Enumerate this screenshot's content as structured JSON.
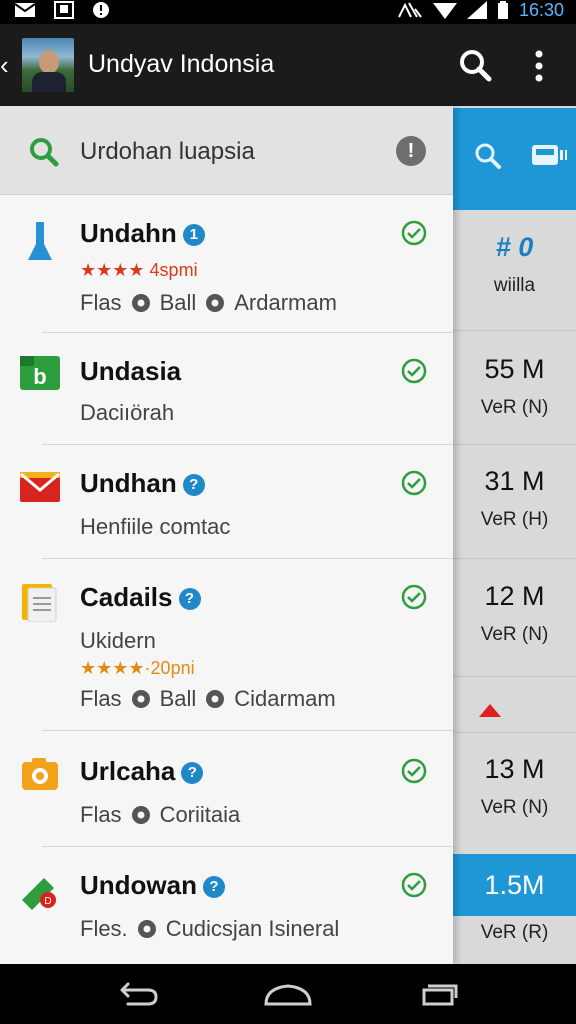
{
  "status_bar": {
    "time": "16:30",
    "icons": [
      "mail-icon",
      "photo-icon",
      "info-icon",
      "data-icon",
      "wifi-icon",
      "signal-icon",
      "battery-icon"
    ]
  },
  "app_bar": {
    "title": "Undyav Indonsia",
    "back_icon": "back-icon",
    "search_icon": "search-icon",
    "more_icon": "more-vert-icon"
  },
  "search": {
    "text": "Urdohan luapsia",
    "icon": "search-icon",
    "info_icon": "info-icon"
  },
  "apps": [
    {
      "name": "Undahn",
      "badge": "1",
      "stars": "★★★★ 4spmi",
      "meta": [
        "Flas",
        "Ball",
        "Ardarmam"
      ],
      "icon": "bookmark-icon",
      "verified": true
    },
    {
      "name": "Undasia",
      "line": "Daciıörah",
      "icon": "b-app-icon",
      "verified": true
    },
    {
      "name": "Undhan",
      "badge": "?",
      "line": "Henfiile comtac",
      "icon": "mail-icon",
      "verified": true
    },
    {
      "name": "Cadails",
      "badge": "?",
      "line": "Ukidern",
      "stars": "★★★★·20pni",
      "meta": [
        "Flas",
        "Ball",
        "Cidarmam"
      ],
      "icon": "notes-icon",
      "verified": true
    },
    {
      "name": "Urlcaha",
      "badge": "?",
      "meta": [
        "Flas",
        "Coriitaia"
      ],
      "icon": "camera-icon",
      "verified": true
    },
    {
      "name": "Undowan",
      "badge": "?",
      "meta": [
        "Fles.",
        "Cudicsjan Isineral"
      ],
      "icon": "tag-icon",
      "verified": true
    }
  ],
  "side_panel": {
    "header": {
      "count": "# 0",
      "label": "wiilla"
    },
    "items": [
      {
        "size": "55 M",
        "sub": "VeR (N)"
      },
      {
        "size": "31 M",
        "sub": "VeR (H)"
      },
      {
        "size": "12 M",
        "sub": "VeR (N)"
      },
      {
        "size": "13 M",
        "sub": "VeR (N)"
      },
      {
        "size": "1.5M",
        "sub": "VeR (R)"
      }
    ]
  },
  "colors": {
    "accent": "#1f97d6",
    "check": "#2e9d3e",
    "star": "#d83b1a",
    "appbar": "#1b1b1b"
  }
}
